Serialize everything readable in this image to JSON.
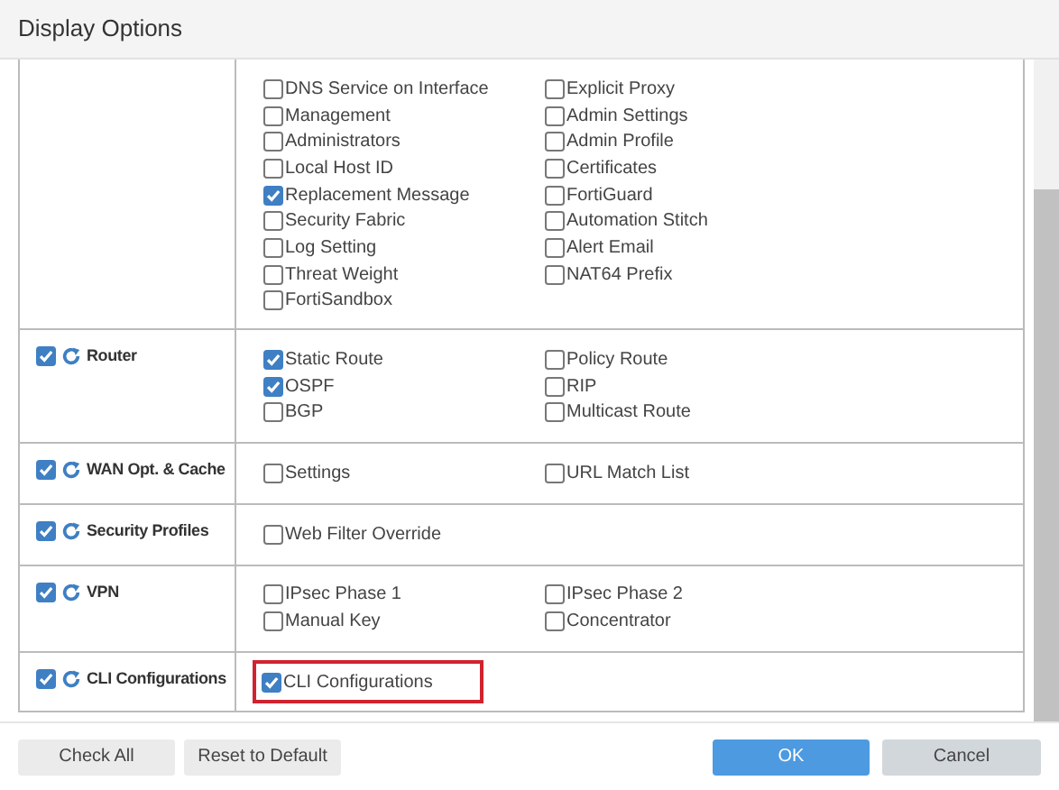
{
  "window": {
    "title": "Display Options"
  },
  "sections": [
    {
      "columns": [
        [
          {
            "label": "DNS Service on Interface",
            "checked": false
          },
          {
            "label": "Management",
            "checked": false
          },
          {
            "label": "Administrators",
            "checked": false
          },
          {
            "label": "Local Host ID",
            "checked": false
          },
          {
            "label": "Replacement Message",
            "checked": true
          },
          {
            "label": "Security Fabric",
            "checked": false
          },
          {
            "label": "Log Setting",
            "checked": false
          },
          {
            "label": "Threat Weight",
            "checked": false
          },
          {
            "label": "FortiSandbox",
            "checked": false
          }
        ],
        [
          {
            "label": "Explicit Proxy",
            "checked": false
          },
          {
            "label": "Admin Settings",
            "checked": false
          },
          {
            "label": "Admin Profile",
            "checked": false
          },
          {
            "label": "Certificates",
            "checked": false
          },
          {
            "label": "FortiGuard",
            "checked": false
          },
          {
            "label": "Automation Stitch",
            "checked": false
          },
          {
            "label": "Alert Email",
            "checked": false
          },
          {
            "label": "NAT64 Prefix",
            "checked": false
          }
        ]
      ]
    },
    {
      "label": "Router",
      "checked": true,
      "columns": [
        [
          {
            "label": "Static Route",
            "checked": true
          },
          {
            "label": "OSPF",
            "checked": true
          },
          {
            "label": "BGP",
            "checked": false
          }
        ],
        [
          {
            "label": "Policy Route",
            "checked": false
          },
          {
            "label": "RIP",
            "checked": false
          },
          {
            "label": "Multicast Route",
            "checked": false
          }
        ]
      ]
    },
    {
      "label": "WAN Opt. & Cache",
      "checked": true,
      "columns": [
        [
          {
            "label": "Settings",
            "checked": false
          }
        ],
        [
          {
            "label": "URL Match List",
            "checked": false
          }
        ]
      ]
    },
    {
      "label": "Security Profiles",
      "checked": true,
      "columns": [
        [
          {
            "label": "Web Filter Override",
            "checked": false
          }
        ]
      ]
    },
    {
      "label": "VPN",
      "checked": true,
      "columns": [
        [
          {
            "label": "IPsec Phase 1",
            "checked": false
          },
          {
            "label": "Manual Key",
            "checked": false
          }
        ],
        [
          {
            "label": "IPsec Phase 2",
            "checked": false
          },
          {
            "label": "Concentrator",
            "checked": false
          }
        ]
      ]
    },
    {
      "label": "CLI Configurations",
      "checked": true,
      "highlighted": true,
      "columns": [
        [
          {
            "label": "CLI Configurations",
            "checked": true
          }
        ]
      ]
    }
  ],
  "buttons": [
    {
      "label": "Check All",
      "kind": "plain"
    },
    {
      "label": "Reset to Default",
      "kind": "plain"
    },
    {
      "label": "OK",
      "kind": "primary"
    },
    {
      "label": "Cancel",
      "kind": "secondary"
    }
  ]
}
